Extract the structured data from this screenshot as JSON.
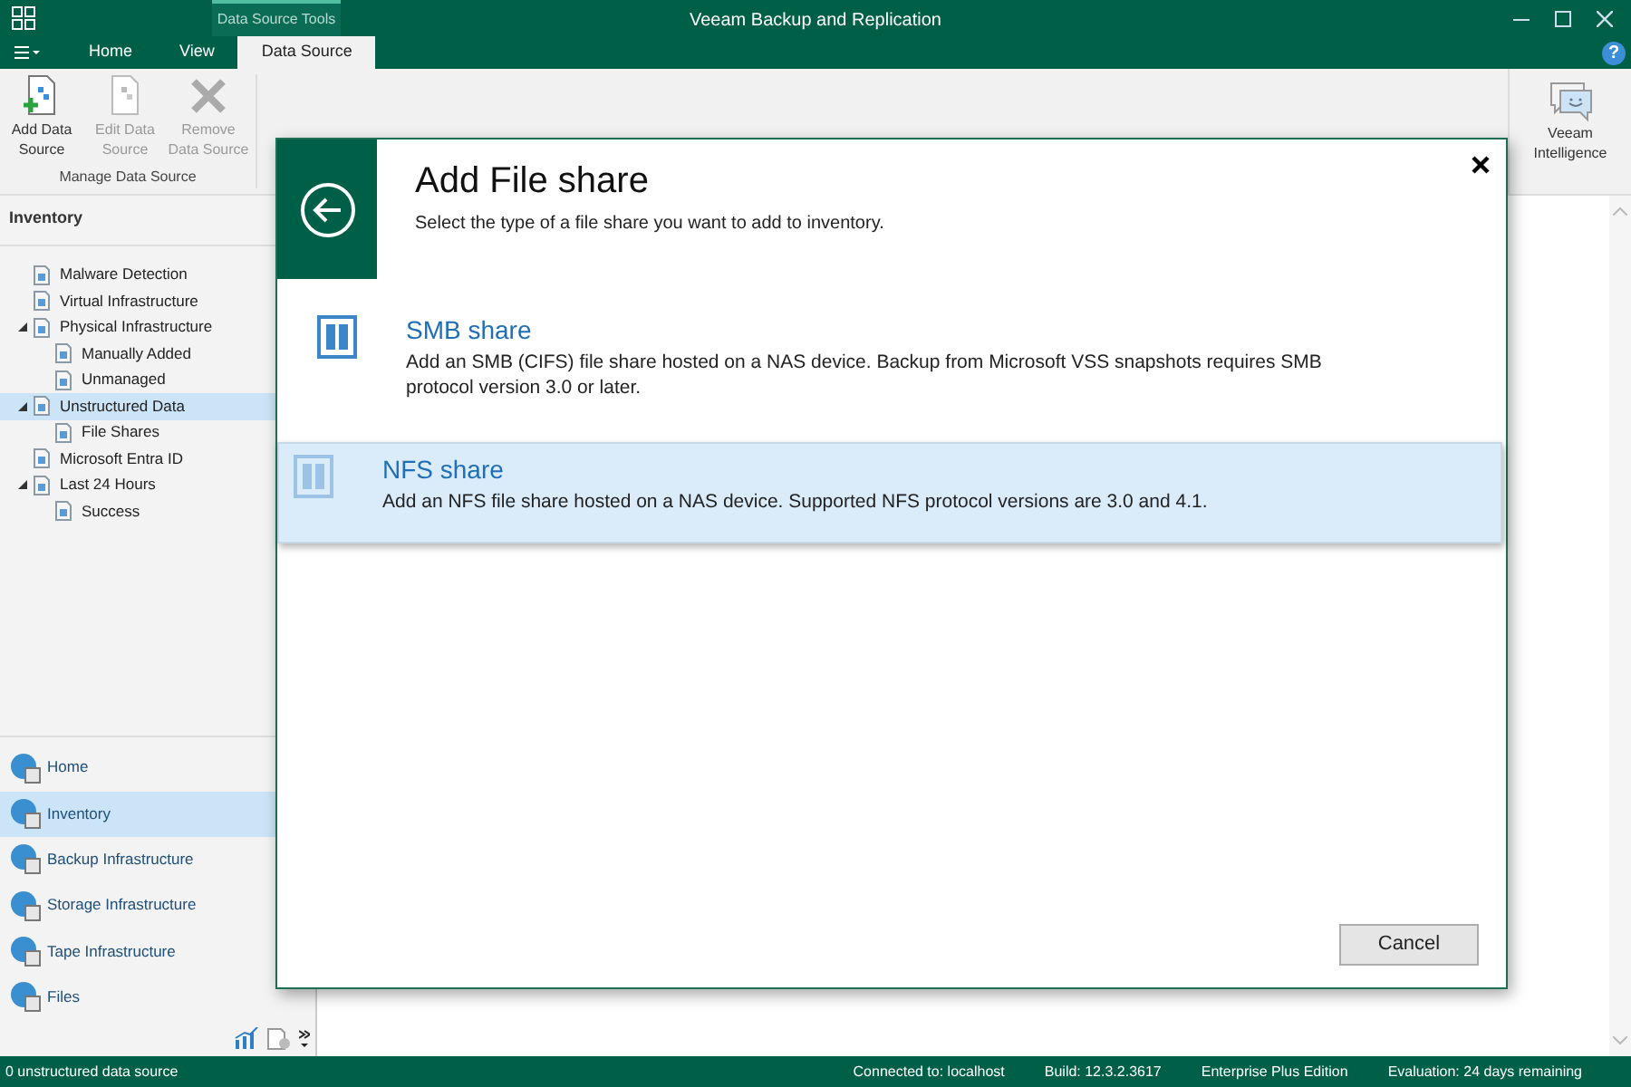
{
  "window": {
    "title": "Veeam Backup and Replication"
  },
  "ribbon": {
    "context_tab": "Data Source Tools",
    "tabs": [
      {
        "label": "Home",
        "selected": false
      },
      {
        "label": "View",
        "selected": false
      },
      {
        "label": "Data Source",
        "selected": true
      }
    ],
    "buttons": [
      {
        "label": "Add Data Source",
        "disabled": false
      },
      {
        "label": "Edit Data Source",
        "disabled": true
      },
      {
        "label": "Remove Data Source",
        "disabled": true
      }
    ],
    "group_label": "Manage Data Source",
    "right_button": "Veeam Intelligence",
    "help": "?"
  },
  "sidebar": {
    "title": "Inventory",
    "tree": [
      {
        "label": "Malware Detection",
        "selected": false
      },
      {
        "label": "Virtual Infrastructure",
        "selected": false
      },
      {
        "label": "Physical Infrastructure",
        "selected": false,
        "expanded": true,
        "children": [
          {
            "label": "Manually Added",
            "selected": false
          },
          {
            "label": "Unmanaged",
            "selected": false
          }
        ]
      },
      {
        "label": "Unstructured Data",
        "selected": true,
        "expanded": true,
        "children": [
          {
            "label": "File Shares",
            "selected": false
          }
        ]
      },
      {
        "label": "Microsoft Entra ID",
        "selected": false
      },
      {
        "label": "Last 24 Hours",
        "selected": false,
        "expanded": true,
        "children": [
          {
            "label": "Success",
            "selected": false
          }
        ]
      }
    ],
    "nav": [
      {
        "label": "Home",
        "selected": false
      },
      {
        "label": "Inventory",
        "selected": true
      },
      {
        "label": "Backup Infrastructure",
        "selected": false
      },
      {
        "label": "Storage Infrastructure",
        "selected": false
      },
      {
        "label": "Tape Infrastructure",
        "selected": false
      },
      {
        "label": "Files",
        "selected": false
      }
    ]
  },
  "dialog": {
    "title": "Add File share",
    "subtitle": "Select the type of a file share you want to add to inventory.",
    "options": [
      {
        "title": "SMB share",
        "description": "Add an SMB (CIFS) file share hosted on a NAS device. Backup from Microsoft VSS snapshots requires SMB protocol version 3.0 or later.",
        "selected": false
      },
      {
        "title": "NFS share",
        "description": "Add an NFS file share hosted on a NAS device. Supported NFS protocol versions are 3.0 and 4.1.",
        "selected": true
      }
    ],
    "cancel": "Cancel"
  },
  "status_bar": {
    "left": "0 unstructured data source",
    "items": [
      "Connected to: localhost",
      "Build: 12.3.2.3617",
      "Enterprise Plus Edition",
      "Evaluation: 24 days remaining"
    ]
  }
}
